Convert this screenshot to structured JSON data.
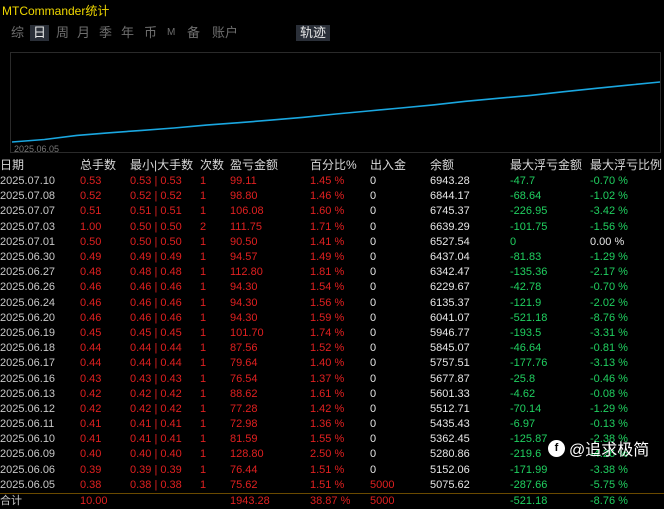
{
  "app": {
    "title": "MTCommander统计"
  },
  "tabs": [
    {
      "label": "综"
    },
    {
      "label": "日"
    },
    {
      "label": "周"
    },
    {
      "label": "月"
    },
    {
      "label": "季"
    },
    {
      "label": "年"
    },
    {
      "label": "币"
    },
    {
      "label": "M"
    },
    {
      "label": "备"
    },
    {
      "label": "账户"
    },
    {
      "label": "轨迹"
    }
  ],
  "active_tab": "日",
  "chart_data": {
    "type": "line",
    "x_start_label": "2025.06.05",
    "x": [
      "2025.06.05",
      "2025.06.06",
      "2025.06.09",
      "2025.06.10",
      "2025.06.11",
      "2025.06.12",
      "2025.06.13",
      "2025.06.16",
      "2025.06.17",
      "2025.06.18",
      "2025.06.19",
      "2025.06.20",
      "2025.06.24",
      "2025.06.26",
      "2025.06.27",
      "2025.06.30",
      "2025.07.01",
      "2025.07.03",
      "2025.07.07",
      "2025.07.08",
      "2025.07.10"
    ],
    "series": [
      {
        "values": [
          5075.62,
          5152.06,
          5280.86,
          5362.45,
          5435.43,
          5512.71,
          5601.33,
          5677.87,
          5757.51,
          5845.07,
          5946.77,
          6041.07,
          6135.37,
          6229.67,
          6342.47,
          6437.04,
          6527.54,
          6639.29,
          6745.37,
          6844.17,
          6943.28
        ],
        "color": "#1aa7e0"
      }
    ]
  },
  "table": {
    "headers": [
      "日期",
      "总手数",
      "最小|大手数",
      "次数",
      "盈亏金额",
      "百分比%",
      "出入金",
      "余额",
      "最大浮亏金额",
      "最大浮亏比例"
    ],
    "rows": [
      [
        "2025.07.10",
        "0.53",
        "0.53 | 0.53",
        "1",
        "99.11",
        "1.45 %",
        "0",
        "6943.28",
        "-47.7",
        "-0.70 %"
      ],
      [
        "2025.07.08",
        "0.52",
        "0.52 | 0.52",
        "1",
        "98.80",
        "1.46 %",
        "0",
        "6844.17",
        "-68.64",
        "-1.02 %"
      ],
      [
        "2025.07.07",
        "0.51",
        "0.51 | 0.51",
        "1",
        "106.08",
        "1.60 %",
        "0",
        "6745.37",
        "-226.95",
        "-3.42 %"
      ],
      [
        "2025.07.03",
        "1.00",
        "0.50 | 0.50",
        "2",
        "111.75",
        "1.71 %",
        "0",
        "6639.29",
        "-101.75",
        "-1.56 %"
      ],
      [
        "2025.07.01",
        "0.50",
        "0.50 | 0.50",
        "1",
        "90.50",
        "1.41 %",
        "0",
        "6527.54",
        "0",
        "0.00 %"
      ],
      [
        "2025.06.30",
        "0.49",
        "0.49 | 0.49",
        "1",
        "94.57",
        "1.49 %",
        "0",
        "6437.04",
        "-81.83",
        "-1.29 %"
      ],
      [
        "2025.06.27",
        "0.48",
        "0.48 | 0.48",
        "1",
        "112.80",
        "1.81 %",
        "0",
        "6342.47",
        "-135.36",
        "-2.17 %"
      ],
      [
        "2025.06.26",
        "0.46",
        "0.46 | 0.46",
        "1",
        "94.30",
        "1.54 %",
        "0",
        "6229.67",
        "-42.78",
        "-0.70 %"
      ],
      [
        "2025.06.24",
        "0.46",
        "0.46 | 0.46",
        "1",
        "94.30",
        "1.56 %",
        "0",
        "6135.37",
        "-121.9",
        "-2.02 %"
      ],
      [
        "2025.06.20",
        "0.46",
        "0.46 | 0.46",
        "1",
        "94.30",
        "1.59 %",
        "0",
        "6041.07",
        "-521.18",
        "-8.76 %"
      ],
      [
        "2025.06.19",
        "0.45",
        "0.45 | 0.45",
        "1",
        "101.70",
        "1.74 %",
        "0",
        "5946.77",
        "-193.5",
        "-3.31 %"
      ],
      [
        "2025.06.18",
        "0.44",
        "0.44 | 0.44",
        "1",
        "87.56",
        "1.52 %",
        "0",
        "5845.07",
        "-46.64",
        "-0.81 %"
      ],
      [
        "2025.06.17",
        "0.44",
        "0.44 | 0.44",
        "1",
        "79.64",
        "1.40 %",
        "0",
        "5757.51",
        "-177.76",
        "-3.13 %"
      ],
      [
        "2025.06.16",
        "0.43",
        "0.43 | 0.43",
        "1",
        "76.54",
        "1.37 %",
        "0",
        "5677.87",
        "-25.8",
        "-0.46 %"
      ],
      [
        "2025.06.13",
        "0.42",
        "0.42 | 0.42",
        "1",
        "88.62",
        "1.61 %",
        "0",
        "5601.33",
        "-4.62",
        "-0.08 %"
      ],
      [
        "2025.06.12",
        "0.42",
        "0.42 | 0.42",
        "1",
        "77.28",
        "1.42 %",
        "0",
        "5512.71",
        "-70.14",
        "-1.29 %"
      ],
      [
        "2025.06.11",
        "0.41",
        "0.41 | 0.41",
        "1",
        "72.98",
        "1.36 %",
        "0",
        "5435.43",
        "-6.97",
        "-0.13 %"
      ],
      [
        "2025.06.10",
        "0.41",
        "0.41 | 0.41",
        "1",
        "81.59",
        "1.55 %",
        "0",
        "5362.45",
        "-125.87",
        "-2.38 %"
      ],
      [
        "2025.06.09",
        "0.40",
        "0.40 | 0.40",
        "1",
        "128.80",
        "2.50 %",
        "0",
        "5280.86",
        "-219.6",
        "-4.26 %"
      ],
      [
        "2025.06.06",
        "0.39",
        "0.39 | 0.39",
        "1",
        "76.44",
        "1.51 %",
        "0",
        "5152.06",
        "-171.99",
        "-3.38 %"
      ],
      [
        "2025.06.05",
        "0.38",
        "0.38 | 0.38",
        "1",
        "75.62",
        "1.51 %",
        "5000",
        "5075.62",
        "-287.66",
        "-5.75 %"
      ]
    ],
    "total": [
      "合计",
      "10.00",
      "",
      "",
      "1943.28",
      "38.87 %",
      "5000",
      "",
      "-521.18",
      "-8.76 %"
    ]
  },
  "watermark": {
    "icon": "f",
    "text": "@追求极简"
  },
  "colors": {
    "title": "#f0d800",
    "red": "#e02020",
    "green": "#20d060",
    "line": "#1aa7e0"
  }
}
